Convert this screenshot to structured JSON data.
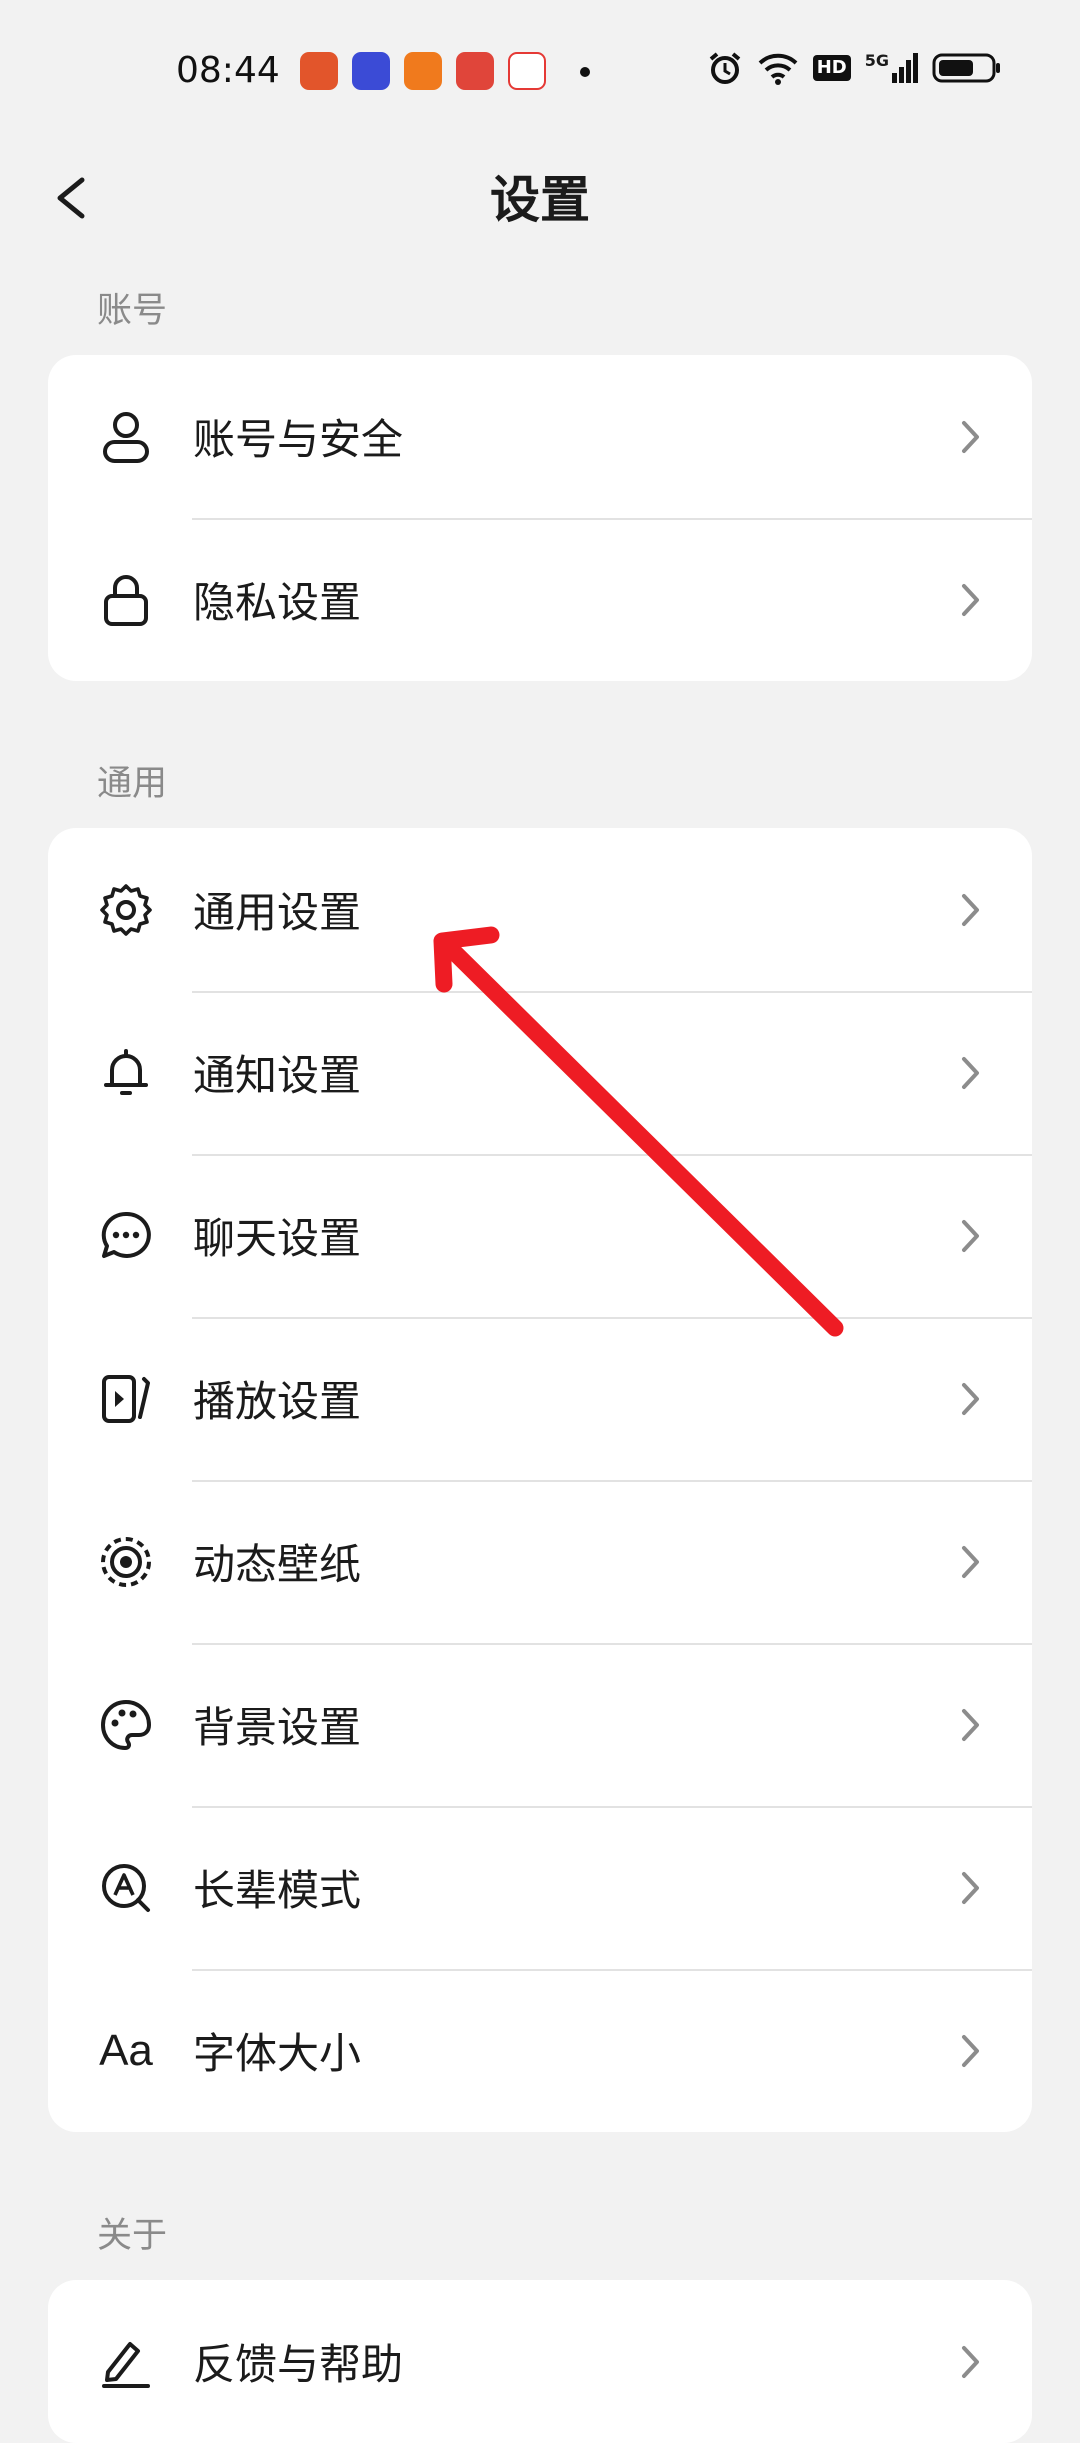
{
  "status_bar": {
    "time": "08:44",
    "network_badge": "HD",
    "signal_label": "5G",
    "app_icon_colors": [
      "#e2552b",
      "#3b4bd6",
      "#f07a1d",
      "#e0453a",
      "#e53935"
    ]
  },
  "header": {
    "title": "设置"
  },
  "sections": [
    {
      "label": "账号",
      "items": [
        {
          "label": "账号与安全",
          "icon": "user-icon"
        },
        {
          "label": "隐私设置",
          "icon": "lock-icon"
        }
      ]
    },
    {
      "label": "通用",
      "items": [
        {
          "label": "通用设置",
          "icon": "gear-icon"
        },
        {
          "label": "通知设置",
          "icon": "bell-icon"
        },
        {
          "label": "聊天设置",
          "icon": "chat-bubble-icon"
        },
        {
          "label": "播放设置",
          "icon": "play-icon"
        },
        {
          "label": "动态壁纸",
          "icon": "live-wallpaper-icon"
        },
        {
          "label": "背景设置",
          "icon": "palette-icon"
        },
        {
          "label": "长辈模式",
          "icon": "elder-mode-icon"
        },
        {
          "label": "字体大小",
          "icon": "font-size-icon",
          "icon_text": "Aa"
        }
      ]
    },
    {
      "label": "关于",
      "items": [
        {
          "label": "反馈与帮助",
          "icon": "edit-icon"
        }
      ]
    }
  ],
  "annotation": {
    "color": "#ee1c24"
  },
  "colors": {
    "background": "#f2f2f2",
    "card": "#ffffff",
    "text": "#1b1b1b",
    "section_label": "#8a8a8a",
    "chevron": "#8c8c8c"
  }
}
